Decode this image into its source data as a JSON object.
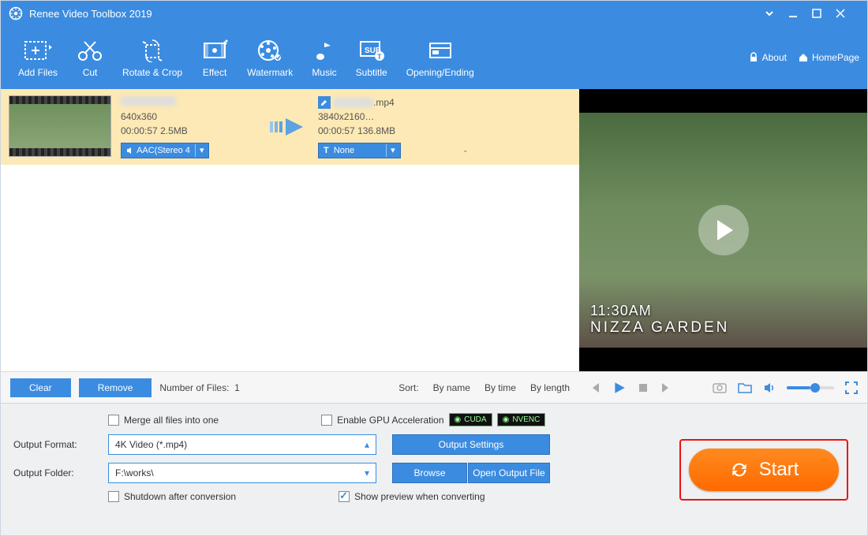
{
  "app": {
    "title": "Renee Video Toolbox 2019"
  },
  "toolbar": {
    "items": [
      {
        "label": "Add Files"
      },
      {
        "label": "Cut"
      },
      {
        "label": "Rotate & Crop"
      },
      {
        "label": "Effect"
      },
      {
        "label": "Watermark"
      },
      {
        "label": "Music"
      },
      {
        "label": "Subtitle"
      },
      {
        "label": "Opening/Ending"
      }
    ],
    "about": "About",
    "homepage": "HomePage"
  },
  "file": {
    "src": {
      "resolution": "640x360",
      "duration": "00:00:57",
      "size": "2.5MB"
    },
    "dst": {
      "ext": ".mp4",
      "resolution": "3840x2160…",
      "duration": "00:00:57",
      "size": "136.8MB"
    },
    "audio_pill": "AAC(Stereo 4",
    "subtitle_pill": "None",
    "dash": "-"
  },
  "preview": {
    "line1": "11:30AM",
    "line2": "NIZZA GARDEN"
  },
  "listbar": {
    "clear": "Clear",
    "remove": "Remove",
    "count_label": "Number of Files:",
    "count_value": "1",
    "sort_label": "Sort:",
    "sort_name": "By name",
    "sort_time": "By time",
    "sort_length": "By length"
  },
  "bottom": {
    "merge": "Merge all files into one",
    "gpu": "Enable GPU Acceleration",
    "cuda": "CUDA",
    "nvenc": "NVENC",
    "output_format_label": "Output Format:",
    "output_format_value": "4K Video (*.mp4)",
    "output_settings": "Output Settings",
    "output_folder_label": "Output Folder:",
    "output_folder_value": "F:\\works\\",
    "browse": "Browse",
    "open_output": "Open Output File",
    "shutdown": "Shutdown after conversion",
    "show_preview": "Show preview when converting",
    "start": "Start"
  }
}
